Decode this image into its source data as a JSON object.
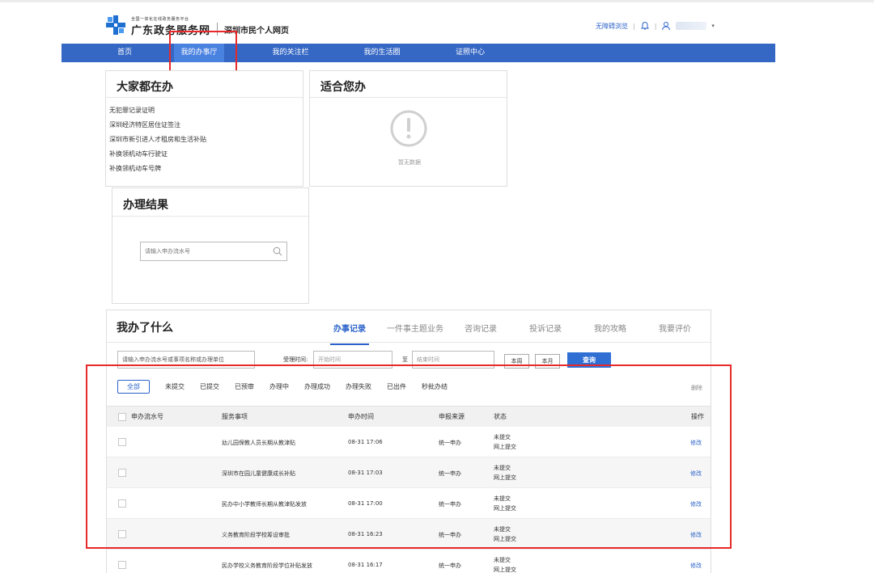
{
  "header": {
    "brand_sub": "全国一体化在线政务服务平台",
    "brand_main": "广东政务服务网",
    "page_title": "深圳市民个人网页",
    "accessibility_link": "无障碍浏览",
    "separator": "|",
    "caret": "▾",
    "accent_color": "#3567c4"
  },
  "nav": {
    "items": [
      "首页",
      "我的办事厅",
      "我的关注栏",
      "我的生活圈",
      "证照中心"
    ],
    "active_index": 1
  },
  "popular": {
    "title": "大家都在办",
    "items": [
      "无犯罪记录证明",
      "深圳经济特区居住证签注",
      "深圳市新引进人才租房和生活补贴",
      "补换领机动车行驶证",
      "补换领机动车号牌"
    ]
  },
  "suggest": {
    "title": "适合您办",
    "empty_text": "暂无数据"
  },
  "result": {
    "title": "办理结果",
    "search_placeholder": "请输入申办流水号"
  },
  "records": {
    "title": "我办了什么",
    "tabs": [
      "办事记录",
      "一件事主题业务",
      "咨询记录",
      "投诉记录",
      "我的攻略",
      "我要评价"
    ],
    "keyword_placeholder": "请输入申办流水号或事项名称或办理单位",
    "time_label": "受理时间:",
    "start_placeholder": "开始时间",
    "to_label": "至",
    "end_placeholder": "结束时间",
    "week_button": "本周",
    "month_button": "本月",
    "query_button": "查询",
    "status_tabs": [
      "全部",
      "未提交",
      "已提交",
      "已预审",
      "办理中",
      "办理成功",
      "办理失败",
      "已出件",
      "秒批办结"
    ],
    "delete_label": "删除",
    "columns": {
      "serial": "申办流水号",
      "item": "服务事项",
      "time": "申办时间",
      "source": "申报来源",
      "status": "状态",
      "action": "操作"
    },
    "rows": [
      {
        "item": "幼儿园保教人员长期从教津贴",
        "time": "08-31 17:06",
        "source": "统一申办",
        "status1": "未提交",
        "status2": "网上提交",
        "action": "修改"
      },
      {
        "item": "深圳市在园儿童健康成长补贴",
        "time": "08-31 17:03",
        "source": "统一申办",
        "status1": "未提交",
        "status2": "网上提交",
        "action": "修改"
      },
      {
        "item": "民办中小学教师长期从教津贴发放",
        "time": "08-31 17:00",
        "source": "统一申办",
        "status1": "未提交",
        "status2": "网上提交",
        "action": "修改"
      },
      {
        "item": "义务教育阶段学校筹设审批",
        "time": "08-31 16:23",
        "source": "统一申办",
        "status1": "未提交",
        "status2": "网上提交",
        "action": "修改"
      },
      {
        "item": "民办学校义务教育阶段学位补贴发放",
        "time": "08-31 16:17",
        "source": "统一申办",
        "status1": "未提交",
        "status2": "网上提交",
        "action": "修改"
      }
    ]
  }
}
